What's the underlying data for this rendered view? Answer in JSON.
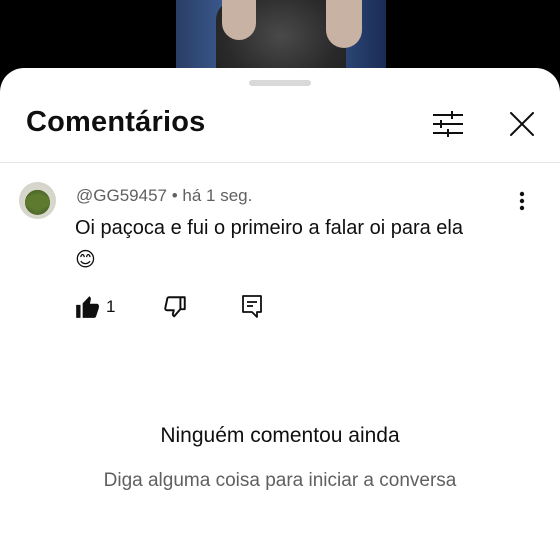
{
  "sheet": {
    "title": "Comentários",
    "filter_icon": "sliders-icon",
    "close_icon": "close-icon"
  },
  "comment": {
    "author": "@GG59457",
    "separator": "•",
    "time": "há 1 seg.",
    "text": "Oi paçoca e fui o primeiro a falar oi para ela",
    "emoji": "😊",
    "likes": "1",
    "more_icon": "more-vertical-icon",
    "like_icon": "thumbs-up-icon",
    "dislike_icon": "thumbs-down-icon",
    "reply_icon": "reply-icon"
  },
  "empty_state": {
    "title": "Ninguém comentou ainda",
    "subtitle": "Diga alguma coisa para iniciar a conversa"
  },
  "colors": {
    "text_primary": "#0f0f0f",
    "text_secondary": "#606060",
    "divider": "#e5e5e5"
  }
}
